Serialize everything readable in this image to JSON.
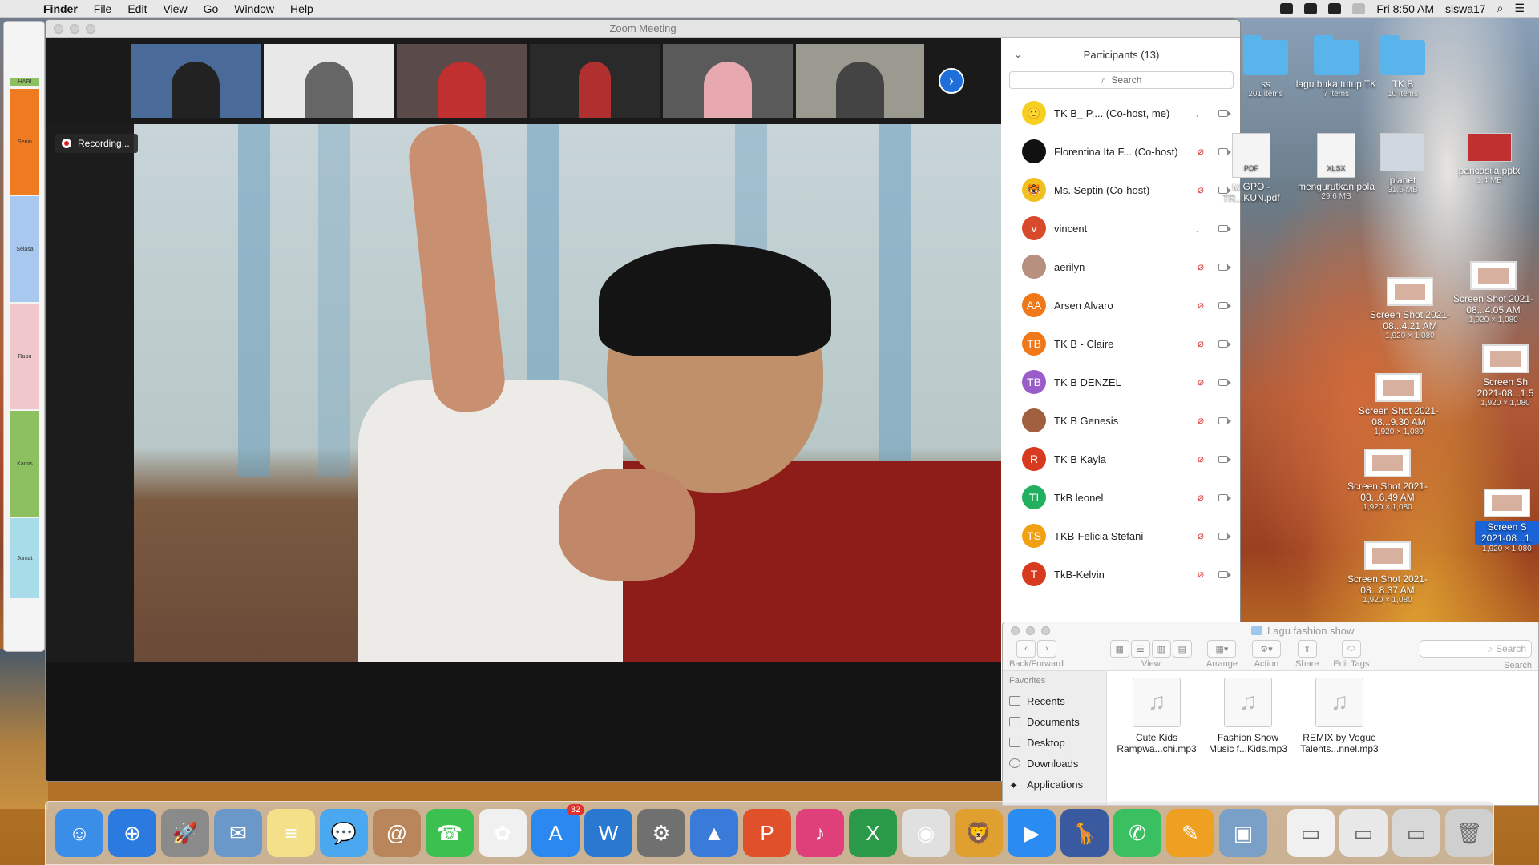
{
  "menubar": {
    "app": "Finder",
    "items": [
      "File",
      "Edit",
      "View",
      "Go",
      "Window",
      "Help"
    ],
    "clock": "Fri 8:50 AM",
    "user": "siswa17"
  },
  "left_window": {
    "header": "HARI",
    "days": [
      "Senin",
      "Selasa",
      "Rabu",
      "Kamis",
      "Jumat"
    ],
    "day_colors": [
      "#f07a20",
      "#a8c8f0",
      "#f0c8cc",
      "#8cc060",
      "#a8dce8"
    ]
  },
  "zoom": {
    "title": "Zoom Meeting",
    "recording_label": "Recording...",
    "thumb_next_icon": "chevron-right-icon"
  },
  "participants": {
    "title": "Participants (13)",
    "search_placeholder": "Search",
    "list": [
      {
        "name": "TK B_ P.... (Co-host, me)",
        "initials": "🙂",
        "color": "#f5d020",
        "mic": "on"
      },
      {
        "name": "Florentina Ita F...  (Co-host)",
        "initials": "",
        "color": "#111111",
        "mic": "muted"
      },
      {
        "name": "Ms. Septin (Co-host)",
        "initials": "🐯",
        "color": "#f0c020",
        "mic": "muted"
      },
      {
        "name": "vincent",
        "initials": "v",
        "color": "#d84a2c",
        "mic": "on"
      },
      {
        "name": "aerilyn",
        "initials": "",
        "color": "#b89080",
        "mic": "muted"
      },
      {
        "name": "Arsen Alvaro",
        "initials": "AA",
        "color": "#f07818",
        "mic": "muted"
      },
      {
        "name": "TK B - Claire",
        "initials": "TB",
        "color": "#f07818",
        "mic": "muted"
      },
      {
        "name": "TK B DENZEL",
        "initials": "TB",
        "color": "#9a5cc8",
        "mic": "muted"
      },
      {
        "name": "TK B Genesis",
        "initials": "",
        "color": "#a06040",
        "mic": "muted"
      },
      {
        "name": "TK B Kayla",
        "initials": "R",
        "color": "#d83a20",
        "mic": "muted"
      },
      {
        "name": "TkB leonel",
        "initials": "TI",
        "color": "#20b060",
        "mic": "muted"
      },
      {
        "name": "TKB-Felicia Stefani",
        "initials": "TS",
        "color": "#f0a010",
        "mic": "muted"
      },
      {
        "name": "TkB-Kelvin",
        "initials": "T",
        "color": "#d83a20",
        "mic": "muted"
      }
    ]
  },
  "desktop": {
    "icons": [
      {
        "label": "ss",
        "sub": "201 items",
        "kind": "folder"
      },
      {
        "label": "lagu buka tutup TK",
        "sub": "7 items",
        "kind": "folder"
      },
      {
        "label": "TK B",
        "sub": "10 items",
        "kind": "folder"
      },
      {
        "label": "M GPO - TR...KUN.pdf",
        "sub": "",
        "kind": "file",
        "ext": "PDF"
      },
      {
        "label": "mengurutkan pola",
        "sub": "29.6 MB",
        "kind": "file",
        "ext": "XLSX"
      },
      {
        "label": "planet",
        "sub": "31.6 MB",
        "kind": "file",
        "ext": ""
      },
      {
        "label": "pancasila.pptx",
        "sub": "1.4 MB",
        "kind": "file",
        "ext": ""
      },
      {
        "label": "Screen Shot 2021-08...4.05 AM",
        "sub": "1,920 × 1,080",
        "kind": "shot"
      },
      {
        "label": "Screen Shot 2021-08...4.21 AM",
        "sub": "1,920 × 1,080",
        "kind": "shot"
      },
      {
        "label": "Screen Sh 2021-08...1.5",
        "sub": "1,920 × 1,080",
        "kind": "shot"
      },
      {
        "label": "Screen Shot 2021-08...9.30 AM",
        "sub": "1,920 × 1,080",
        "kind": "shot"
      },
      {
        "label": "Screen Shot 2021-08...6.49 AM",
        "sub": "1,920 × 1,080",
        "kind": "shot"
      },
      {
        "label": "Screen S 2021-08...1.",
        "sub": "1,920 × 1,080",
        "kind": "shot"
      },
      {
        "label": "Screen Shot 2021-08...8.37 AM",
        "sub": "1,920 × 1,080",
        "kind": "shot"
      }
    ]
  },
  "finder": {
    "title": "Lagu fashion show",
    "toolbar": {
      "back_forward": "Back/Forward",
      "view": "View",
      "arrange": "Arrange",
      "action": "Action",
      "share": "Share",
      "edit_tags": "Edit Tags",
      "search_label": "Search",
      "search_placeholder": "Search"
    },
    "sidebar_heading": "Favorites",
    "sidebar": [
      "Recents",
      "Documents",
      "Desktop",
      "Downloads",
      "Applications"
    ],
    "files": [
      {
        "line1": "Cute Kids",
        "line2": "Rampwa...chi.mp3"
      },
      {
        "line1": "Fashion Show",
        "line2": "Music f...Kids.mp3"
      },
      {
        "line1": "REMIX by Vogue",
        "line2": "Talents...nnel.mp3"
      }
    ]
  },
  "dock": {
    "app_store_badge": "32",
    "apps": [
      {
        "name": "finder",
        "glyph": "☺",
        "color": "#3a8ee8"
      },
      {
        "name": "safari",
        "glyph": "⊕",
        "color": "#2a7ae0"
      },
      {
        "name": "launchpad",
        "glyph": "🚀",
        "color": "#8a8a8a"
      },
      {
        "name": "mail",
        "glyph": "✉",
        "color": "#6a98c8"
      },
      {
        "name": "notes",
        "glyph": "≡",
        "color": "#f4e088"
      },
      {
        "name": "messages",
        "glyph": "💬",
        "color": "#4aa8f0"
      },
      {
        "name": "contacts",
        "glyph": "@",
        "color": "#b8865a"
      },
      {
        "name": "facetime",
        "glyph": "☎",
        "color": "#3cc050"
      },
      {
        "name": "photos",
        "glyph": "✿",
        "color": "#f0f0f0"
      },
      {
        "name": "app-store",
        "glyph": "A",
        "color": "#2a88f0"
      },
      {
        "name": "word",
        "glyph": "W",
        "color": "#2a78d0"
      },
      {
        "name": "system-preferences",
        "glyph": "⚙",
        "color": "#707070"
      },
      {
        "name": "keynote",
        "glyph": "▲",
        "color": "#3a7ad8"
      },
      {
        "name": "powerpoint",
        "glyph": "P",
        "color": "#e0502a"
      },
      {
        "name": "itunes",
        "glyph": "♪",
        "color": "#e0407a"
      },
      {
        "name": "excel",
        "glyph": "X",
        "color": "#2a9a48"
      },
      {
        "name": "chrome",
        "glyph": "◉",
        "color": "#e0e0e0"
      },
      {
        "name": "lion-app",
        "glyph": "🦁",
        "color": "#e0a030"
      },
      {
        "name": "zoom",
        "glyph": "▶",
        "color": "#2a8cf0"
      },
      {
        "name": "giraffe-app",
        "glyph": "🦒",
        "color": "#3a5aa0"
      },
      {
        "name": "whatsapp",
        "glyph": "✆",
        "color": "#3ac060"
      },
      {
        "name": "paint-app",
        "glyph": "✎",
        "color": "#f0a020"
      },
      {
        "name": "preview",
        "glyph": "▣",
        "color": "#7aa0c8"
      }
    ],
    "minimized": [
      {
        "name": "minimized-zoom",
        "color": "#f0f0f0"
      },
      {
        "name": "minimized-spreadsheet",
        "color": "#e8e8e8"
      },
      {
        "name": "minimized-window",
        "color": "#d8d8d8"
      },
      {
        "name": "trash",
        "color": "#cfcfcf"
      }
    ]
  }
}
